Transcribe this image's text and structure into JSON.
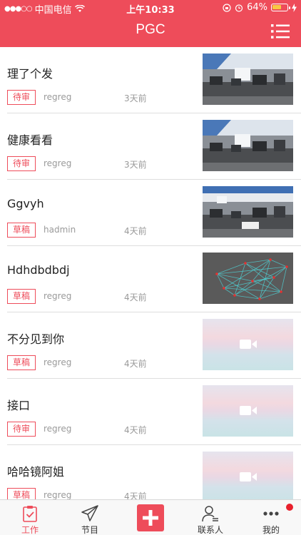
{
  "status_bar": {
    "carrier": "中国电信",
    "time": "上午10:33",
    "battery": "64%",
    "battery_level": 0.64,
    "signal_icon": "signal-dots-icon",
    "wifi_icon": "wifi-icon",
    "lock_icon": "orientation-lock-icon",
    "alarm_icon": "alarm-icon",
    "charge_icon": "charging-bolt-icon"
  },
  "nav": {
    "title": "PGC",
    "menu_icon": "list-menu-icon"
  },
  "colors": {
    "brand": "#ee4c5a",
    "badge": "#ee4c5a",
    "meta_text": "#9a9a9a",
    "notification": "#e8202c"
  },
  "items": [
    {
      "title": "理了个发",
      "status": "待审",
      "author": "regreg",
      "time": "3天前",
      "thumb": "office-photo"
    },
    {
      "title": "健康看看",
      "status": "待审",
      "author": "regreg",
      "time": "3天前",
      "thumb": "office-photo"
    },
    {
      "title": "Ggvyh",
      "status": "草稿",
      "author": "hadmin",
      "time": "4天前",
      "thumb": "office-photo-2"
    },
    {
      "title": "Hdhdbdbdj",
      "status": "草稿",
      "author": "regreg",
      "time": "4天前",
      "thumb": "network-graph"
    },
    {
      "title": "不分见到你",
      "status": "草稿",
      "author": "regreg",
      "time": "4天前",
      "thumb": "video-placeholder"
    },
    {
      "title": "接口",
      "status": "待审",
      "author": "regreg",
      "time": "4天前",
      "thumb": "video-placeholder"
    },
    {
      "title": "哈哈镜阿姐",
      "status": "草稿",
      "author": "regreg",
      "time": "4天前",
      "thumb": "video-placeholder"
    }
  ],
  "tabs": [
    {
      "label": "工作",
      "icon": "clipboard-check-icon",
      "active": true
    },
    {
      "label": "节目",
      "icon": "paper-plane-icon",
      "active": false
    },
    {
      "label": "",
      "icon": "add-icon",
      "active": false
    },
    {
      "label": "联系人",
      "icon": "contact-icon",
      "active": false
    },
    {
      "label": "我的",
      "icon": "more-dots-icon",
      "active": false
    }
  ]
}
